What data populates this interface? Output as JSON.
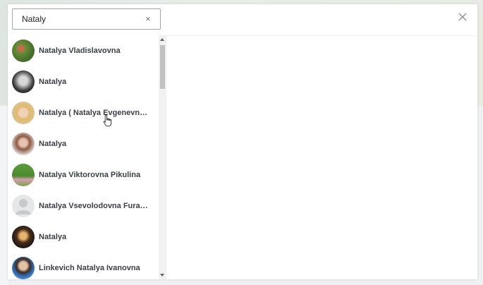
{
  "search": {
    "value": "Nataly",
    "clear_glyph": "×"
  },
  "results": [
    {
      "name": "Natalya Vladislavovna",
      "avatar": "photo-garden"
    },
    {
      "name": "Natalya",
      "avatar": "photo-bw-portrait"
    },
    {
      "name": "Natalya ( Natalya Evgenevna Fo...",
      "avatar": "photo-blonde"
    },
    {
      "name": "Natalya",
      "avatar": "photo-woman-outdoor"
    },
    {
      "name": "Natalya Viktorovna Pikulina",
      "avatar": "photo-green-field"
    },
    {
      "name": "Natalya Vsevolodovna Furashova",
      "avatar": "default-user-icon"
    },
    {
      "name": "Natalya",
      "avatar": "photo-dark-portrait"
    },
    {
      "name": "Linkevich Natalya Ivanovna",
      "avatar": "photo-blue-shirt"
    }
  ],
  "colors": {
    "name_text": "#3a3f44",
    "border": "#9fa6ad",
    "scroll_thumb": "#c1c1c1"
  }
}
